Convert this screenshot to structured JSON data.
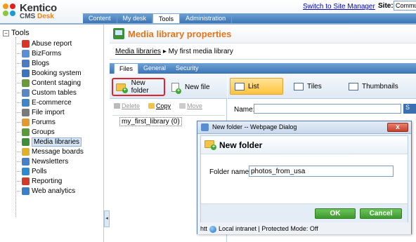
{
  "app": {
    "logo_text": "Kentico",
    "logo_sub_1": "CMS",
    "logo_sub_2": "Desk"
  },
  "header": {
    "switch_link": "Switch to Site Manager",
    "site_label": "Site:",
    "site_value": "Commu",
    "tabs": [
      {
        "label": "Content"
      },
      {
        "label": "My desk"
      },
      {
        "label": "Tools"
      },
      {
        "label": "Administration"
      }
    ],
    "active_tab": "Tools"
  },
  "sidebar": {
    "root_label": "Tools",
    "items": [
      {
        "label": "Abuse report",
        "color": "#d8342c"
      },
      {
        "label": "BizForms",
        "color": "#5a8fd4"
      },
      {
        "label": "Blogs",
        "color": "#4b7cc2"
      },
      {
        "label": "Booking system",
        "color": "#3d74c0"
      },
      {
        "label": "Content staging",
        "color": "#6a9a3a"
      },
      {
        "label": "Custom tables",
        "color": "#5b86c4"
      },
      {
        "label": "E-commerce",
        "color": "#3f86c8"
      },
      {
        "label": "File import",
        "color": "#7a7a7a"
      },
      {
        "label": "Forums",
        "color": "#e39a2c"
      },
      {
        "label": "Groups",
        "color": "#5a9a3a"
      },
      {
        "label": "Media libraries",
        "color": "#3f8f3a"
      },
      {
        "label": "Message boards",
        "color": "#e1b12c"
      },
      {
        "label": "Newsletters",
        "color": "#4a7fc8"
      },
      {
        "label": "Polls",
        "color": "#2e8ad0"
      },
      {
        "label": "Reporting",
        "color": "#d23b2a"
      },
      {
        "label": "Web analytics",
        "color": "#3b7fc6"
      }
    ],
    "selected": "Media libraries"
  },
  "content": {
    "title": "Media library properties",
    "breadcrumb_link": "Media libraries",
    "breadcrumb_current": "My first media library",
    "sub_tabs": [
      {
        "label": "Files"
      },
      {
        "label": "General"
      },
      {
        "label": "Security"
      }
    ],
    "active_sub_tab": "Files",
    "new_folder_label": "New folder",
    "new_file_label": "New file",
    "delete_label": "Delete",
    "copy_label": "Copy",
    "move_label": "Move",
    "library_node": "my_first_library (0)",
    "views": {
      "list": "List",
      "tiles": "Tiles",
      "thumbnails": "Thumbnails"
    },
    "name_label": "Name:",
    "search_btn": "S"
  },
  "dialog": {
    "window_title": "New folder -- Webpage Dialog",
    "close_glyph": "x",
    "heading": "New folder",
    "field_label": "Folder name:",
    "field_value": "photos_from_usa",
    "ok_label": "OK",
    "cancel_label": "Cancel",
    "status_prefix": "htt",
    "status_text": "Local intranet | Protected Mode: Off"
  }
}
